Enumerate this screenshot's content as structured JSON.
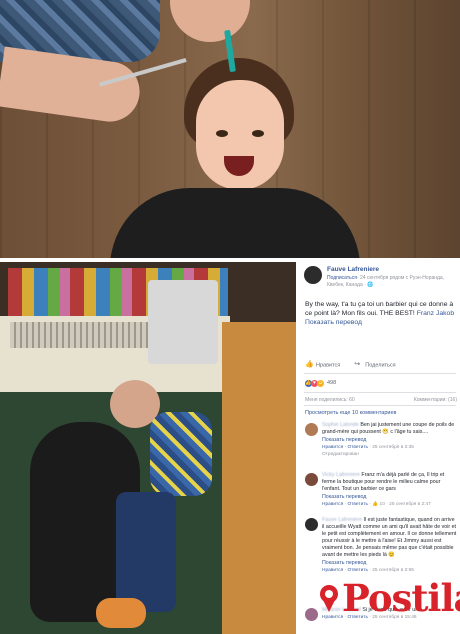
{
  "post": {
    "author": "Fauve Lafreniere",
    "follow": "Подписаться",
    "meta": "· 24 сентября рядом с Руэн-Норанда, Квебек, Канада · ",
    "globe": "🌐",
    "text": "By the way, t'a tu ça toi un barbier qui ce donne à ce point là? Mon fils oui. THE BEST!",
    "mention": "Franz Jakob",
    "translate": "Показать перевод",
    "like_label": "Нравится",
    "share_label": "Поделиться",
    "reaction_count": "498",
    "shares": "Меня поделились: 60",
    "comments_count": "Комментарии: (16)",
    "more_comments": "Просмотреть еще 10 комментариев"
  },
  "comments": [
    {
      "name": "Sophie Lalonde",
      "text": "Ben jai justement une coupe de poils de grand-mère qui poussent 😁 c l'âge tu sais....",
      "translate": "Показать перевод",
      "like": "Нравится",
      "reply": "Ответить",
      "time": "· 25 сентября в 2:35",
      "edited": "Отредактирован",
      "reacts": "",
      "avatar_color": "#b07a55"
    },
    {
      "name": "Vicky Lafreniere",
      "text": "Franz m'a déjà parlé de ça, Il trip et ferme la boutique pour rendre le milieu calme pour l'enfant. Tout un barbier ce gars",
      "translate": "Показать перевод",
      "like": "Нравится",
      "reply": "Ответить",
      "time": "· 25 сентября в 2:47",
      "edited": "",
      "reacts": "10",
      "avatar_color": "#7a4a3a"
    },
    {
      "name": "Fauve Lafreniere",
      "text": "Il est juste fantastique, quand on arrive il accueille Wyatt comme un ami qu'il avait hâte de voir et le petit est complètement en amour. Il ce donne tellement pour réussir à le mettre à l'aise! Et Jimmy aussi est vraiment bon. Je pensais même pas que c'était possible avant de mettre les pieds là 😊",
      "translate": "Показать перевод",
      "like": "Нравится",
      "reply": "Ответить",
      "time": "· 25 сентября в 2:55",
      "edited": "",
      "reacts": "",
      "avatar_color": "#2c2c2c"
    },
    {
      "name": "Melanie Lessard",
      "text": "Si je viens qu'à avoir un",
      "translate": "",
      "like": "Нравится",
      "reply": "Ответить",
      "time": "· 25 сентября в 15:46",
      "edited": "",
      "reacts": "",
      "avatar_color": "#9b6a8a"
    }
  ],
  "watermark": {
    "text": "Postila"
  }
}
